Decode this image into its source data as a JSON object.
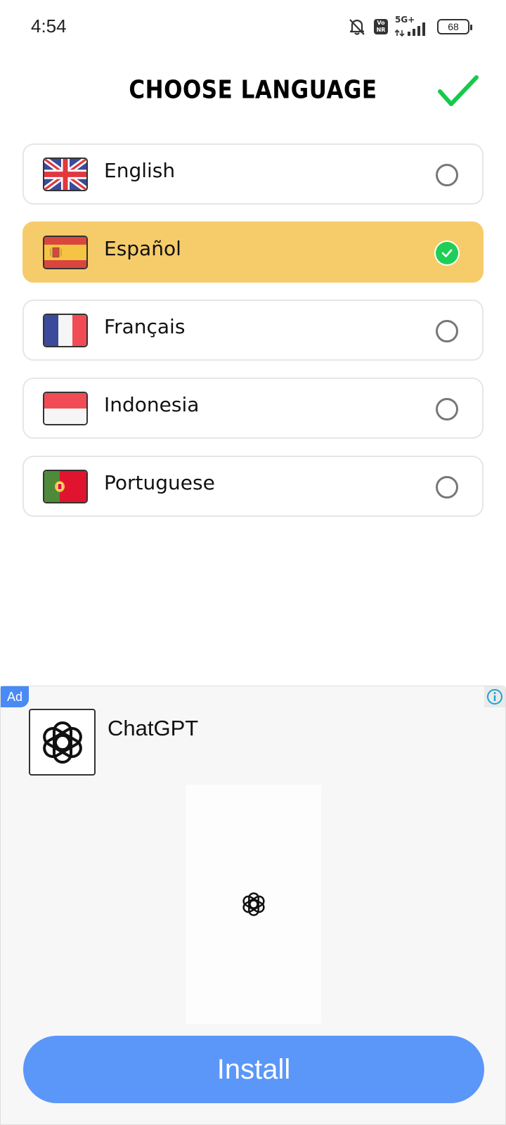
{
  "status_bar": {
    "time": "4:54",
    "battery": "68",
    "network": "5G+",
    "volte": "Vo NR",
    "icons": [
      "bell-muted-icon",
      "volte-icon",
      "signal-icon",
      "battery-icon"
    ]
  },
  "header": {
    "title": "CHOOSE LANGUAGE",
    "confirm_icon": "checkmark-icon",
    "confirm_color": "#16c94c"
  },
  "languages": [
    {
      "label": "English",
      "flag": "uk-flag-icon",
      "selected": false
    },
    {
      "label": "Español",
      "flag": "spain-flag-icon",
      "selected": true
    },
    {
      "label": "Français",
      "flag": "france-flag-icon",
      "selected": false
    },
    {
      "label": "Indonesia",
      "flag": "indonesia-flag-icon",
      "selected": false
    },
    {
      "label": "Portuguese",
      "flag": "portugal-flag-icon",
      "selected": false
    }
  ],
  "colors": {
    "selected_bg": "#f6cc6a",
    "check_green": "#1fcf55",
    "install_blue": "#5b97f9",
    "ad_badge": "#4a8af4"
  },
  "ad": {
    "badge": "Ad",
    "info_icon": "info-icon",
    "app_name": "ChatGPT",
    "app_icon": "openai-logo-icon",
    "install_label": "Install"
  }
}
